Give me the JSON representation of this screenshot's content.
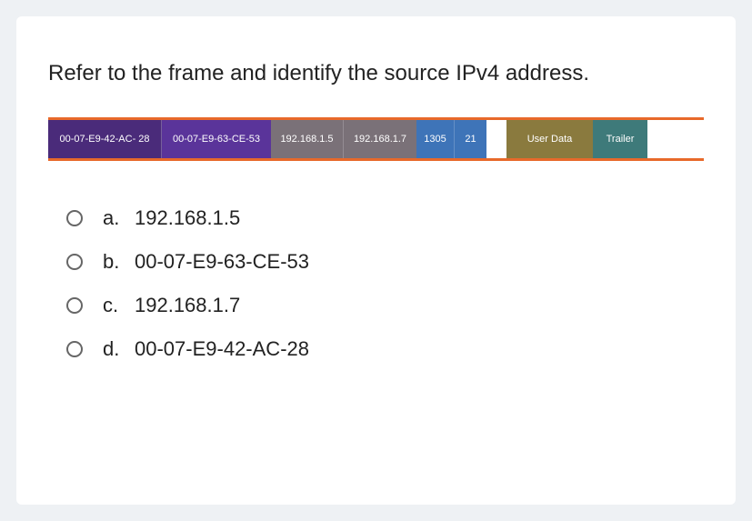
{
  "question": "Refer to the frame and identify the source IPv4 address.",
  "frame": {
    "segments": [
      {
        "label": "00-07-E9-42-AC- 28"
      },
      {
        "label": "00-07-E9-63-CE-53"
      },
      {
        "label": "192.168.1.5"
      },
      {
        "label": "192.168.1.7"
      },
      {
        "label": "1305"
      },
      {
        "label": "21"
      },
      {
        "label": ""
      },
      {
        "label": "User Data"
      },
      {
        "label": "Trailer"
      }
    ]
  },
  "options": [
    {
      "letter": "a.",
      "text": "192.168.1.5"
    },
    {
      "letter": "b.",
      "text": "00-07-E9-63-CE-53"
    },
    {
      "letter": "c.",
      "text": "192.168.1.7"
    },
    {
      "letter": "d.",
      "text": "00-07-E9-42-AC-28"
    }
  ]
}
